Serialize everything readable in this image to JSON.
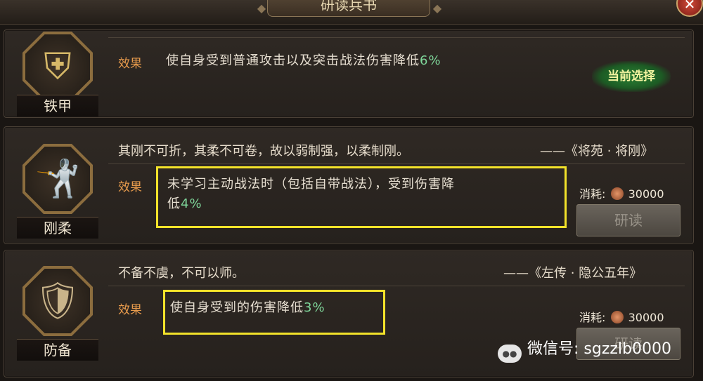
{
  "header": {
    "title": "研读兵书",
    "close_glyph": "✕"
  },
  "accent_colors": {
    "effect_label": "#e69a4c",
    "value_green": "#7fd79a",
    "highlight": "#f2e22a"
  },
  "books": [
    {
      "name": "铁甲",
      "icon": "armor-icon",
      "effect_label": "效果",
      "effect_text": "使自身受到普通攻击以及突击战法伤害降低",
      "effect_value": "6%",
      "status_badge": "当前选择"
    },
    {
      "name": "刚柔",
      "icon": "martial-stance-icon",
      "quote": "其刚不可折，其柔不可卷，故以弱制强，以柔制刚。",
      "source": "——《将苑 · 将刚》",
      "effect_label": "效果",
      "effect_text_line1": "未学习主动战法时（包括自带战法），受到伤害降",
      "effect_text_line2": "低",
      "effect_value": "4%",
      "cost_label": "消耗:",
      "cost_value": "30000",
      "button_label": "研读"
    },
    {
      "name": "防备",
      "icon": "guard-soldier-icon",
      "quote": "不备不虞，不可以师。",
      "source": "——《左传 · 隐公五年》",
      "effect_label": "效果",
      "effect_text": "使自身受到的伤害降低",
      "effect_value": "3%",
      "cost_label": "消耗:",
      "cost_value": "30000",
      "button_label": "研读"
    }
  ],
  "watermark": {
    "text": "微信号: sgzzlb0000",
    "icon": "wechat-icon"
  }
}
